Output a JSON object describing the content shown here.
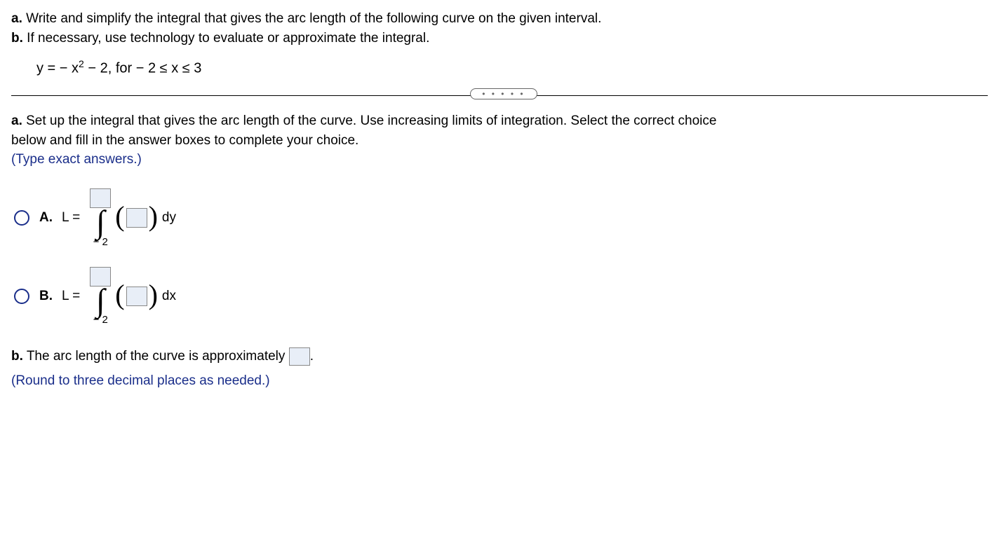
{
  "prompt": {
    "a_label": "a.",
    "a_text": " Write and simplify the integral that gives the arc length of the following curve on the given interval.",
    "b_label": "b.",
    "b_text": " If necessary, use technology to evaluate or approximate the integral."
  },
  "equation": {
    "lhs": "y = − x",
    "exp": "2",
    "rhs": " − 2, for  − 2 ≤ x ≤ 3"
  },
  "section_a": {
    "label": "a.",
    "line1": " Set up the integral that gives the arc length of the curve. Use increasing limits of integration. Select the correct choice",
    "line2": "below and fill in the answer boxes to complete your choice.",
    "hint": "(Type exact answers.)"
  },
  "choices": {
    "A": {
      "letter": "A.",
      "L": "L =",
      "lower": "− 2",
      "dvar": "dy"
    },
    "B": {
      "letter": "B.",
      "L": "L =",
      "lower": "− 2",
      "dvar": "dx"
    }
  },
  "section_b": {
    "label": "b.",
    "text_before": " The arc length of the curve is approximately ",
    "period": ".",
    "hint": "(Round to three decimal places as needed.)"
  },
  "handle_dots": "• • • • •"
}
